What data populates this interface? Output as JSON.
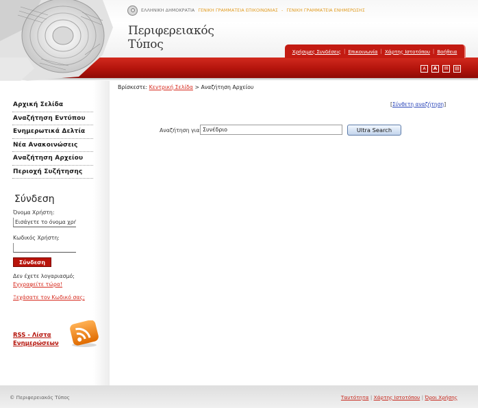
{
  "header": {
    "gov_ministry": "ΕΛΛΗΝΙΚΗ ΔΗΜΟΚΡΑΤΙΑ",
    "gov_secretariat_comm": "ΓΕΝΙΚΗ ΓΡΑΜΜΑΤΕΙΑ ΕΠΙΚΟΙΝΩΝΙΑΣ",
    "gov_separator": "-",
    "gov_secretariat_info": "ΓΕΝΙΚΗ ΓΡΑΜΜΑΤΕΙΑ ΕΝΗΜΕΡΩΣΗΣ",
    "title_line1": "Περιφερειακός",
    "title_line2": "Τύπος",
    "nav": [
      {
        "label": "Χρήσιμες Συνδέσεις"
      },
      {
        "label": "Επικοινωνία"
      },
      {
        "label": "Χάρτης Ιστοτόπου"
      },
      {
        "label": "Βοήθεια"
      }
    ],
    "nav_separator": "|",
    "tools": [
      {
        "icon": "font-smaller-icon",
        "glyph": "A"
      },
      {
        "icon": "font-larger-icon",
        "glyph": "A"
      },
      {
        "icon": "email-icon",
        "glyph": "✉"
      },
      {
        "icon": "print-icon",
        "glyph": "▤"
      }
    ],
    "colors": {
      "brand_red": "#c31b12",
      "gov_orange": "#e19a1c"
    }
  },
  "sidebar": {
    "menu": [
      {
        "label": "Αρχική Σελίδα"
      },
      {
        "label": "Αναζήτηση Εντύπου"
      },
      {
        "label": "Ενημερωτικά Δελτία"
      },
      {
        "label": "Νέα Ανακοινώσεις"
      },
      {
        "label": "Αναζήτηση Αρχείου"
      },
      {
        "label": "Περιοχή Συζήτησης"
      }
    ],
    "login": {
      "title": "Σύνδεση",
      "username_label": "Όνομα Χρήστη:",
      "username_value": "Εισάγετε το όνομα χρήστη",
      "password_label": "Κωδικός Χρήστη:",
      "password_value": "",
      "submit": "Σύνδεση",
      "no_account": "Δεν έχετε λογαριασμό;",
      "register": "Εγγραφείτε τώρα!",
      "forgot": "Ξεχάσατε τον Κωδικό σας;"
    },
    "rss": {
      "label": "RSS - Λίστα Ενημερώσεων",
      "icon": "rss-icon"
    }
  },
  "main": {
    "breadcrumb": {
      "prefix": "Βρίσκεστε:",
      "home": "Κεντρική Σελίδα",
      "sep": ">",
      "current": "Αναζήτηση Αρχείου"
    },
    "advanced": {
      "open": "[",
      "label": "Σύνθετη αναζήτηση",
      "close": "]"
    },
    "search": {
      "label": "Αναζήτηση για",
      "value": "Συνέδριο",
      "button": "Ultra Search"
    }
  },
  "footer": {
    "copyright": "© Περιφερειακός Τύπος",
    "links": [
      {
        "label": "Ταυτότητα"
      },
      {
        "label": "Χάρτης Ιστοτόπου"
      },
      {
        "label": "Όροι Χρήσης"
      }
    ],
    "separator": "|"
  }
}
